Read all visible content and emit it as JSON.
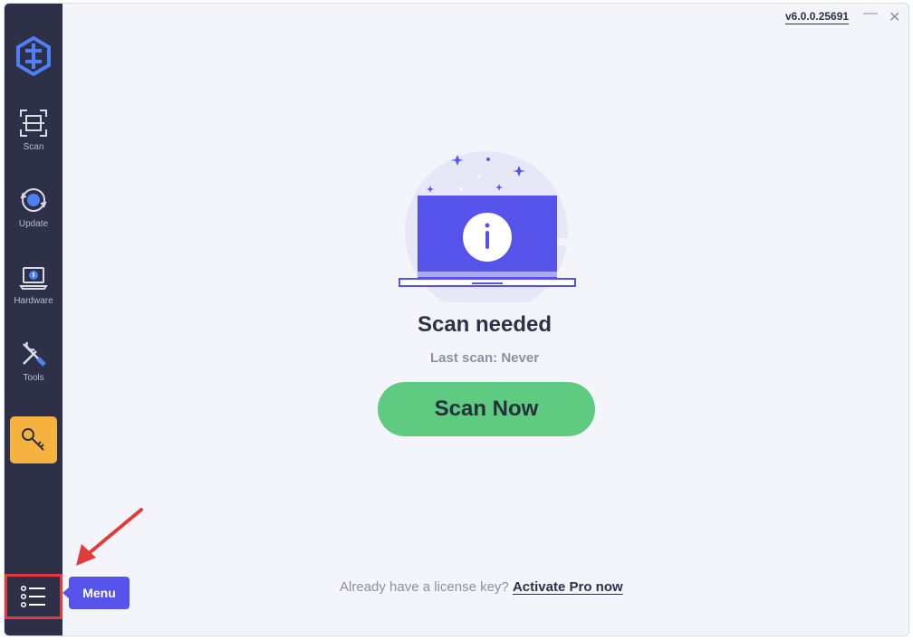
{
  "window": {
    "version": "v6.0.0.25691",
    "minimize_label": "—",
    "close_label": "✕"
  },
  "sidebar": {
    "items": [
      {
        "label": "Scan",
        "icon": "scan-icon"
      },
      {
        "label": "Update",
        "icon": "update-icon"
      },
      {
        "label": "Hardware",
        "icon": "hardware-icon"
      },
      {
        "label": "Tools",
        "icon": "tools-icon"
      }
    ],
    "key_icon": "key-icon",
    "menu_icon": "menu-list-icon"
  },
  "tooltip": {
    "label": "Menu"
  },
  "main": {
    "title": "Scan needed",
    "subtitle": "Last scan: Never",
    "scan_button": "Scan Now",
    "license_prompt": "Already have a license key?",
    "license_link": "Activate Pro now"
  },
  "colors": {
    "sidebar": "#2d3046",
    "accent": "#5553e9",
    "key_button": "#f6b23f",
    "scan_button": "#5ecb80",
    "highlight": "#e23b3b"
  }
}
